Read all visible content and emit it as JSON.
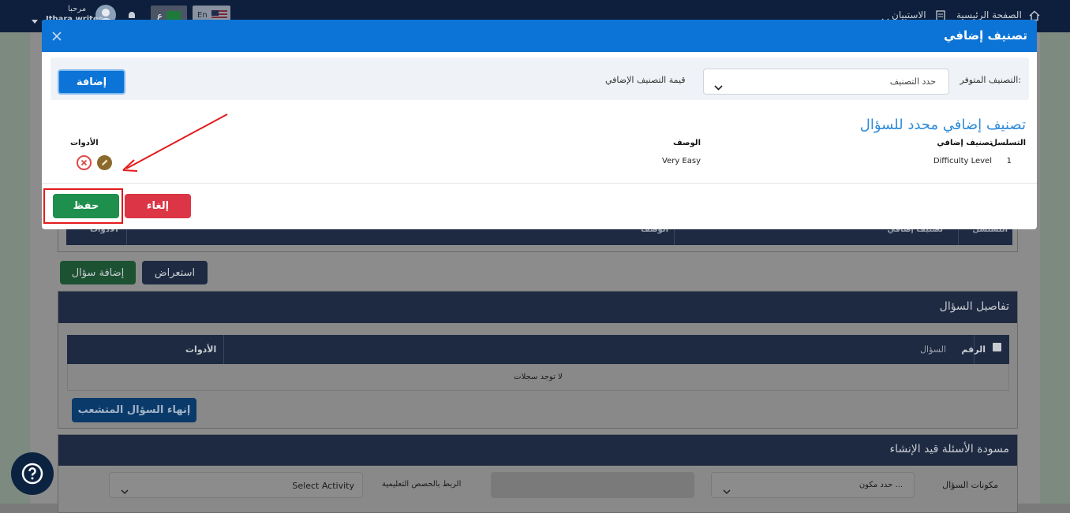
{
  "topbar": {
    "home": "الصفحة الرئيسية",
    "survey": "الاستبيان",
    "lang_en": "En",
    "lang_ar": "ع",
    "greeting": "مرحبا",
    "username": "Ithara writes"
  },
  "modal": {
    "title": "تصنيف إضافي",
    "filter": {
      "available_label": "التصنيف المتوفر:",
      "select_placeholder": "حدد التصنيف",
      "value_label": "قيمة التصنيف الإضافي",
      "add_button": "إضافة"
    },
    "section_title": "تصنيف إضافي محدد للسؤال",
    "table": {
      "headers": {
        "serial": "التسلسل",
        "classification": "تصنيف إضافي",
        "description": "الوصف",
        "tools": "الأدوات"
      },
      "rows": [
        {
          "serial": "1",
          "classification": "Difficulty Level",
          "description": "Very Easy"
        }
      ]
    },
    "cancel_button": "إلغاء",
    "save_button": "حفظ"
  },
  "background": {
    "table_headers": {
      "serial": "التسلسل",
      "classification": "تصنيف إضافي",
      "description": "الوصف",
      "tools": "الأدوات"
    },
    "view_button": "استعراض",
    "add_question_button": "إضافة سؤال",
    "question_details": {
      "title": "تفاصيل السؤال",
      "headers": {
        "number": "الرقم",
        "question": "السؤال",
        "tools": "الأدوات"
      },
      "empty": "لا توجد سجلات",
      "end_branch_button": "إنهاء السؤال المتشعب"
    },
    "draft": {
      "title": "مسودة الأسئلة قيد الإنشاء",
      "components_label": "مكونات السؤال",
      "components_placeholder": "حدد مكون ...",
      "link_label": "الربط بالحصص التعليمية",
      "activity_placeholder": "Select Activity"
    }
  },
  "colors": {
    "primary": "#0b74d6",
    "save": "#1f8f4e",
    "cancel": "#dc3545",
    "annotation": "#e31b1b",
    "navy": "#1e2a42"
  }
}
